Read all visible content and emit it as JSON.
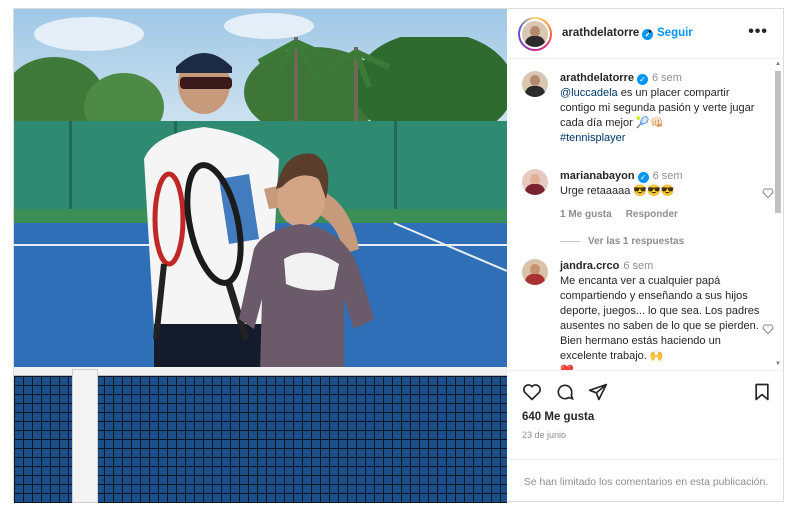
{
  "post": {
    "author": "arathdelatorre",
    "follow_label": "Seguir",
    "separator": "•",
    "more_label": "•••",
    "caption": {
      "user": "arathdelatorre",
      "time": "6 sem",
      "mention": "@luccadela",
      "text": " es un placer compartir contigo mi segunda pasión y verte jugar cada día mejor 🎾👊🏻",
      "hashtag": "#tennisplayer"
    },
    "comments": [
      {
        "user": "marianabayon",
        "verified": true,
        "time": "6 sem",
        "text": "Urge retaaaaa 😎😎😎",
        "likes_label": "1 Me gusta",
        "reply_label": "Responder",
        "view_replies": "Ver las 1 respuestas"
      },
      {
        "user": "jandra.crco",
        "verified": false,
        "time": "6 sem",
        "text": "Me encanta ver a cualquier papá compartiendo y enseñando a sus hijos deporte, juegos... lo que sea. Los padres ausentes no saben de lo que se pierden. Bien hermano estás haciendo un excelente trabajo. 🙌",
        "extra": "❤️"
      }
    ],
    "likes": "640 Me gusta",
    "date": "23 de junio",
    "comments_limited": "Se han limitado los comentarios en esta publicación."
  },
  "icons": {
    "verified": "✓",
    "scroll_up": "▲",
    "scroll_down": "▼"
  },
  "colors": {
    "accent": "#0095f6",
    "mention": "#00376b",
    "muted": "#8e8e8e"
  }
}
